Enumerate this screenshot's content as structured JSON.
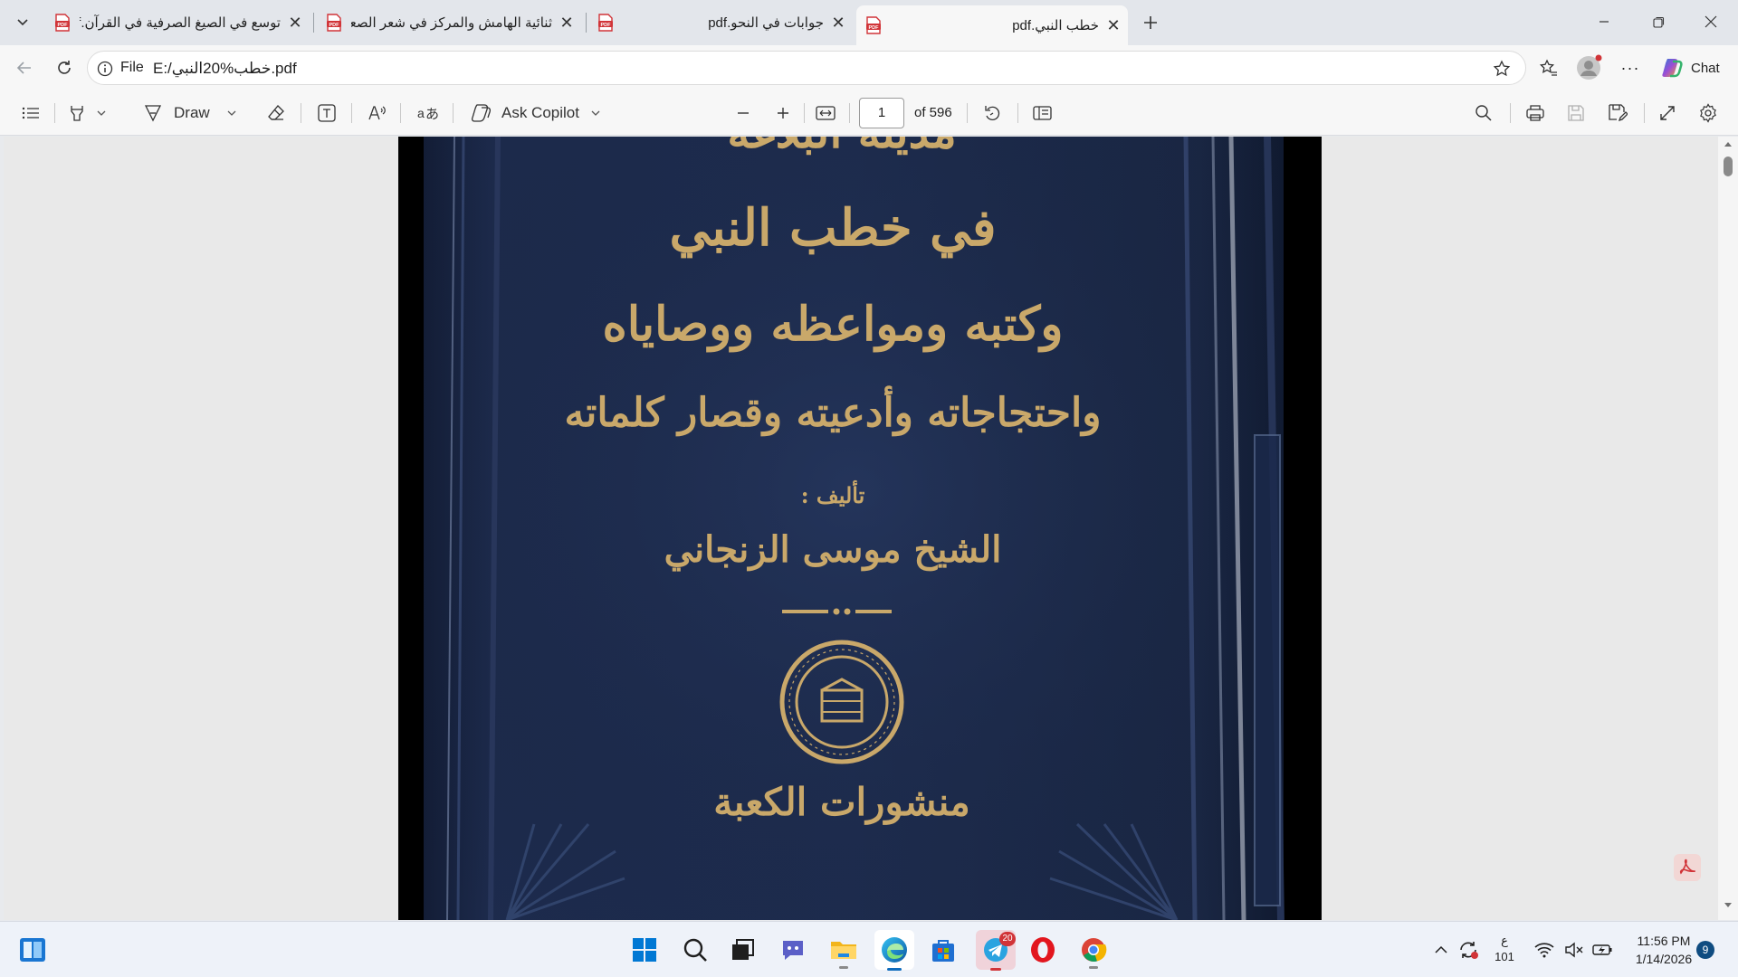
{
  "tabs": [
    {
      "title": "توسع في الصيغ الصرفية في القرآن.pdf",
      "favicon": "pdf-icon",
      "active": false
    },
    {
      "title": "ثنائية الهامش والمركز في شعر الصعا",
      "favicon": "pdf-icon",
      "active": false
    },
    {
      "title": "جوابات في النحو.pdf",
      "favicon": "pdf-icon",
      "active": false
    },
    {
      "title": "خطب النبي.pdf",
      "favicon": "pdf-icon",
      "active": true
    }
  ],
  "address": {
    "scheme_label": "File",
    "url": "E:/خطب%20النبي.pdf"
  },
  "copilot_chat_label": "Chat",
  "pdf_toolbar": {
    "draw_label": "Draw",
    "ask_copilot_label": "Ask Copilot",
    "page_number": "1",
    "page_total": "of 596"
  },
  "book_cover": {
    "top_partial": "مدينة البلاغة",
    "line1": "في خطب النبي",
    "line2": "وكتبه ومواعظه ووصاياه",
    "line3": "واحتجاجاته وأدعيته وقصار كلماته",
    "author_label": "تأليف :",
    "author": "الشيخ موسى الزنجاني",
    "publisher": "منشورات الكعبة",
    "cover_color": "#1c2a4a",
    "gold_color": "#c9a86a"
  },
  "taskbar": {
    "telegram_badge": "20",
    "lang_top": "ع",
    "lang_bottom": "101",
    "time": "11:56 PM",
    "date": "1/14/2026",
    "notification_count": "9"
  },
  "colors": {
    "accent": "#0f6cbd",
    "pdf_red": "#d13438"
  }
}
